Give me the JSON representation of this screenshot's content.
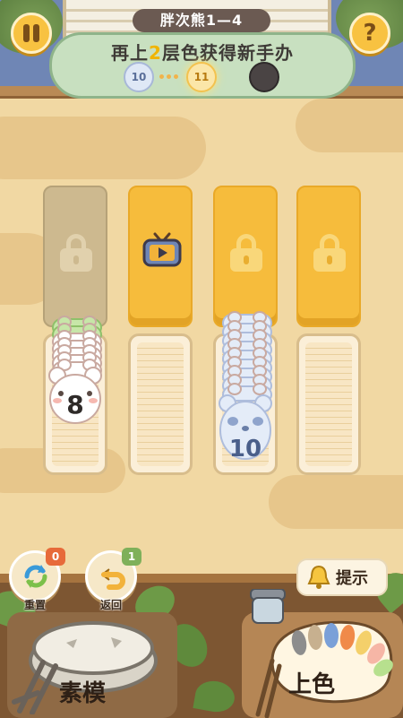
{
  "header": {
    "level_title": "胖次熊1—4",
    "goal_text_before": "再上",
    "goal_number": "2",
    "goal_text_after": "层色获得新手办",
    "progress": [
      {
        "label": "10",
        "state": "done"
      },
      {
        "label": "11",
        "state": "current"
      },
      {
        "label": "",
        "state": "locked"
      }
    ],
    "pause_icon": "pause-icon",
    "help_label": "?"
  },
  "columns": [
    {
      "top_state": "locked-dim",
      "bear_count": 8,
      "bear_label": "8",
      "bear_color": "#ffffff",
      "ear_color": "#a9d58a"
    },
    {
      "top_state": "video-unlock",
      "bear_count": 0,
      "bear_label": ""
    },
    {
      "top_state": "locked-gold",
      "bear_count": 10,
      "bear_label": "10",
      "bear_color": "#e4ecf8",
      "ear_color": "#bccbe6"
    },
    {
      "top_state": "locked-gold",
      "bear_count": 0,
      "bear_label": ""
    }
  ],
  "controls": {
    "reset_label": "重置",
    "reset_count": "0",
    "undo_label": "返回",
    "undo_count": "1",
    "hint_label": "提示",
    "plaster_label": "素模",
    "paint_label": "上色"
  },
  "colors": {
    "accent_gold": "#f6bc3c",
    "goal_green": "#c8e0c0",
    "badge_red": "#e76a3a",
    "badge_green": "#7fb05a"
  }
}
